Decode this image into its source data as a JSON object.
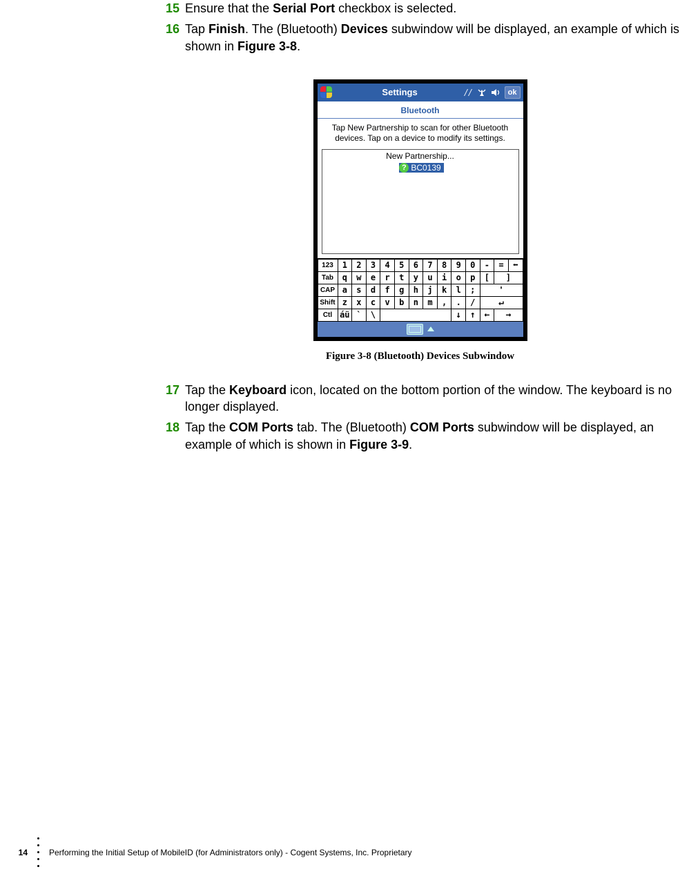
{
  "steps": {
    "s15": {
      "num": "15",
      "t1": "Ensure that the ",
      "b1": "Serial Port",
      "t2": " checkbox is selected."
    },
    "s16": {
      "num": "16",
      "t1": "Tap ",
      "b1": "Finish",
      "t2": ". The (Bluetooth) ",
      "b2": "Devices",
      "t3": " subwindow will be displayed, an example of which is shown in ",
      "b3": "Figure 3-8",
      "t4": "."
    },
    "s17": {
      "num": "17",
      "t1": "Tap the ",
      "b1": "Keyboard",
      "t2": " icon, located on the bottom portion of the window. The keyboard is no longer displayed."
    },
    "s18": {
      "num": "18",
      "t1": "Tap the ",
      "b1": "COM Ports",
      "t2": " tab. The (Bluetooth) ",
      "b2": "COM Ports",
      "t3": " subwindow will be displayed, an example of which is shown in ",
      "b3": "Figure 3-9",
      "t4": "."
    }
  },
  "figure": {
    "caption": "Figure 3-8 (Bluetooth) Devices Subwindow",
    "titlebar": {
      "title": "Settings",
      "ok": "ok"
    },
    "subtitle": "Bluetooth",
    "hint": "Tap New Partnership to scan for other Bluetooth devices. Tap on a device to modify its settings.",
    "listbox": {
      "new_partnership": "New Partnership...",
      "device_icon_char": "?",
      "selected_device": "BC0139"
    },
    "keyboard": {
      "row1": [
        "123",
        "1",
        "2",
        "3",
        "4",
        "5",
        "6",
        "7",
        "8",
        "9",
        "0",
        "-",
        "=",
        "⬅"
      ],
      "row2": [
        "Tab",
        "q",
        "w",
        "e",
        "r",
        "t",
        "y",
        "u",
        "i",
        "o",
        "p",
        "[",
        "]"
      ],
      "row3": [
        "CAP",
        "a",
        "s",
        "d",
        "f",
        "g",
        "h",
        "j",
        "k",
        "l",
        ";",
        "'"
      ],
      "row4": [
        "Shift",
        "z",
        "x",
        "c",
        "v",
        "b",
        "n",
        "m",
        ",",
        ".",
        "/",
        "↵"
      ],
      "row5": [
        "Ctl",
        "áü",
        "`",
        "\\",
        "",
        "↓",
        "↑",
        "←",
        "→"
      ]
    }
  },
  "footer": {
    "page_no": "14",
    "text": "Performing the Initial Setup of MobileID (for Administrators only)  - Cogent Systems, Inc. Proprietary"
  }
}
